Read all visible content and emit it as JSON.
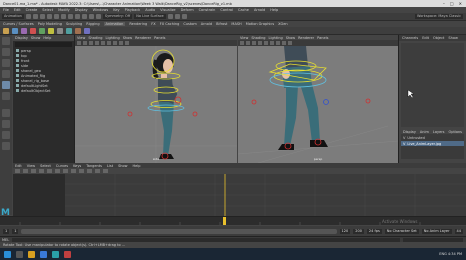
{
  "window": {
    "title": "Dance01.ma_1.ma* - Autodesk MAYA 2022.3: C:\\Users\\...\\Character Animation\\Week 3 Walk\\DanceRig_v2\\scenes\\DanceRig_v1.mb"
  },
  "menubar": {
    "items": [
      "File",
      "Edit",
      "Create",
      "Select",
      "Modify",
      "Display",
      "Windows",
      "Key",
      "Playback",
      "Audio",
      "Visualize",
      "Deform",
      "Constrain",
      "Control",
      "Cache",
      "Arnold",
      "Help"
    ]
  },
  "statusline": {
    "mode": "Animation",
    "workspace": "Workspace: Maya Classic",
    "symmetry": "Symmetry: Off",
    "no_live": "No Live Surface"
  },
  "shelf": {
    "tabs": [
      "Curves / Surfaces",
      "Poly Modeling",
      "Sculpting",
      "Rigging",
      "Animation",
      "Rendering",
      "FX",
      "FX Caching",
      "Custom",
      "Arnold",
      "Bifrost",
      "MASH",
      "Motion Graphics",
      "XGen"
    ],
    "active": "Animation"
  },
  "outliner": {
    "menu": [
      "Display",
      "Show",
      "Help"
    ],
    "items": [
      "persp",
      "top",
      "front",
      "side",
      "shaneI_geo",
      "Animated_Rig",
      "shaneI_rig_base",
      "defaultLightSet",
      "defaultObjectSet"
    ]
  },
  "viewport_left": {
    "menu": [
      "View",
      "Shading",
      "Lighting",
      "Show",
      "Renderer",
      "Panels"
    ],
    "camera": "side"
  },
  "viewport_right": {
    "menu": [
      "View",
      "Shading",
      "Lighting",
      "Show",
      "Renderer",
      "Panels"
    ],
    "camera": "persp"
  },
  "channelbox": {
    "tabs": [
      "Channels",
      "Edit",
      "Object",
      "Show"
    ]
  },
  "layers": {
    "tabs": [
      "Display",
      "Anim"
    ],
    "menu": [
      "Layers",
      "Options",
      "Help"
    ],
    "rows": [
      {
        "label": "Untrusted"
      },
      {
        "label": "Live_AnimLayer.jpg"
      }
    ]
  },
  "graph_editor": {
    "menu": [
      "Edit",
      "View",
      "Select",
      "Curves",
      "Keys",
      "Tangents",
      "List",
      "Show",
      "Help"
    ]
  },
  "timeslider": {
    "current_frame": "44"
  },
  "rangeslider": {
    "start": "1",
    "start_inner": "1",
    "end_inner": "120",
    "end": "200",
    "fps": "24 fps",
    "char_set": "No Character Set",
    "anim_layer": "No Anim Layer"
  },
  "cmdline": {
    "label": "MEL"
  },
  "helpline": {
    "text": "Rotate Tool: Use manipulator to rotate object(s). Ctrl+LMB+drag to ..."
  },
  "watermark": {
    "text": "Activate Windows"
  },
  "taskbar": {
    "tray": "ENG  4:34 PM"
  },
  "colors": {
    "accent": "#4f6a87",
    "timeslider_marker": "#e8c02c",
    "ik_handle": "#e8e030"
  }
}
